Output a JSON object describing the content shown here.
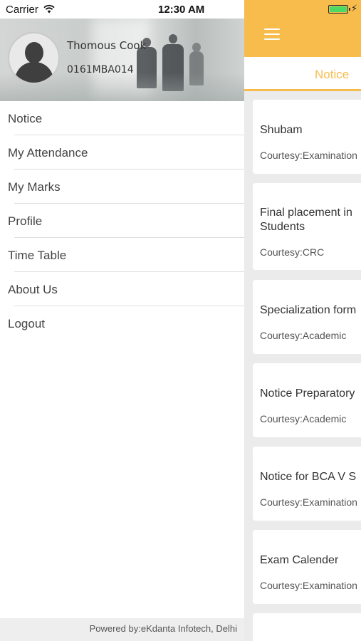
{
  "status_bar": {
    "carrier": "Carrier",
    "time": "12:30 AM"
  },
  "drawer": {
    "user": {
      "name": "Thomous Cook",
      "id": "0161MBA014"
    },
    "menu": [
      {
        "label": "Notice"
      },
      {
        "label": "My Attendance"
      },
      {
        "label": "My Marks"
      },
      {
        "label": "Profile"
      },
      {
        "label": "Time Table"
      },
      {
        "label": "About Us"
      },
      {
        "label": "Logout"
      }
    ],
    "footer": "Powered by:eKdanta Infotech, Delhi"
  },
  "main": {
    "tab_label": "Notice",
    "notices": [
      {
        "title": "Shubam",
        "courtesy": "Courtesy:Examination"
      },
      {
        "title": "Final placement in Students",
        "courtesy": "Courtesy:CRC"
      },
      {
        "title": "Specialization form",
        "courtesy": "Courtesy:Academic"
      },
      {
        "title": "Notice Preparatory",
        "courtesy": "Courtesy:Academic"
      },
      {
        "title": "Notice for BCA V S",
        "courtesy": "Courtesy:Examination"
      },
      {
        "title": "Exam Calender",
        "courtesy": "Courtesy:Examination"
      }
    ]
  },
  "colors": {
    "accent": "#f7bc4c",
    "battery": "#4cd964",
    "background": "#ebebeb"
  },
  "icons": [
    "wifi-icon",
    "battery-icon",
    "charging-bolt-icon",
    "hamburger-menu-icon",
    "avatar-placeholder-icon"
  ]
}
